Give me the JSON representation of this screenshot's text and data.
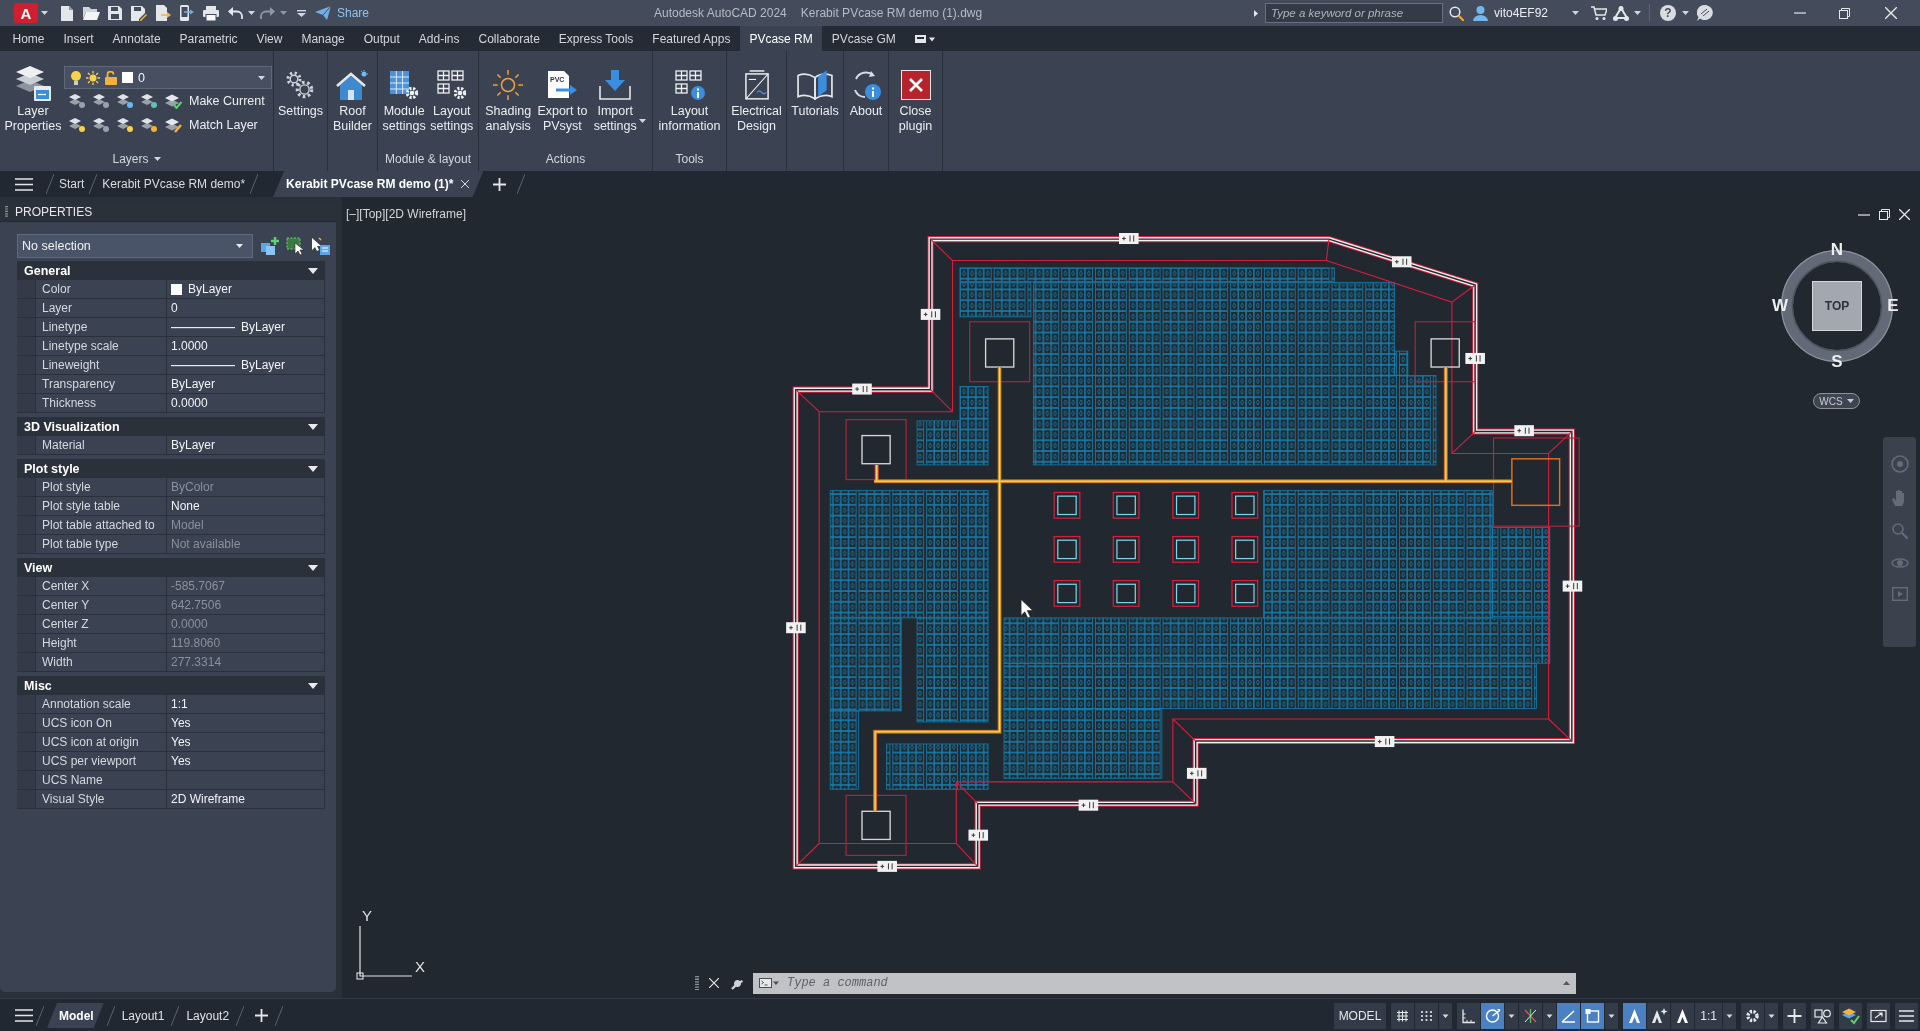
{
  "window": {
    "logo_letter": "A",
    "share_label": "Share",
    "app_title": "Autodesk AutoCAD 2024",
    "document_title": "Kerabit PVcase RM demo (1).dwg",
    "search": {
      "placeholder": "Type a keyword or phrase"
    },
    "user": "vito4EF92",
    "help_symbol": "?"
  },
  "ribbon_tabs": [
    {
      "label": "Home",
      "selected": false
    },
    {
      "label": "Insert",
      "selected": false
    },
    {
      "label": "Annotate",
      "selected": false
    },
    {
      "label": "Parametric",
      "selected": false
    },
    {
      "label": "View",
      "selected": false
    },
    {
      "label": "Manage",
      "selected": false
    },
    {
      "label": "Output",
      "selected": false
    },
    {
      "label": "Add-ins",
      "selected": false
    },
    {
      "label": "Collaborate",
      "selected": false
    },
    {
      "label": "Express Tools",
      "selected": false
    },
    {
      "label": "Featured Apps",
      "selected": false
    },
    {
      "label": "PVcase RM",
      "selected": true
    },
    {
      "label": "PVcase GM",
      "selected": false
    }
  ],
  "ribbon_panels": [
    {
      "kind": "layers",
      "title": "Layers",
      "layer_properties": "Layer\nProperties",
      "current_layer": "0",
      "buttons": [
        "Make Current",
        "Match Layer"
      ]
    },
    {
      "kind": "buttons",
      "buttons": [
        {
          "label": "Settings"
        }
      ]
    },
    {
      "kind": "buttons",
      "buttons": [
        {
          "label": "Roof\nBuilder"
        }
      ]
    },
    {
      "kind": "buttons",
      "title": "Module & layout",
      "buttons": [
        {
          "label": "Module\nsettings"
        },
        {
          "label": "Layout\nsettings"
        }
      ]
    },
    {
      "kind": "buttons",
      "title": "Actions",
      "buttons": [
        {
          "label": "Shading\nanalysis"
        },
        {
          "label": "Export to\nPVsyst",
          "icon_text": "PVC"
        },
        {
          "label": "Import\nsettings",
          "has_menu": true
        }
      ]
    },
    {
      "kind": "buttons",
      "title": "Tools",
      "buttons": [
        {
          "label": "Layout\ninformation"
        }
      ]
    },
    {
      "kind": "buttons",
      "buttons": [
        {
          "label": "Electrical\nDesign"
        }
      ]
    },
    {
      "kind": "buttons",
      "buttons": [
        {
          "label": "Tutorials"
        }
      ]
    },
    {
      "kind": "buttons",
      "buttons": [
        {
          "label": "About"
        }
      ]
    },
    {
      "kind": "buttons",
      "buttons": [
        {
          "label": "Close\nplugin"
        }
      ]
    }
  ],
  "file_tabs": [
    {
      "label": "Start",
      "selected": false
    },
    {
      "label": "Kerabit PVcase RM demo*",
      "selected": false
    },
    {
      "label": "Kerabit PVcase RM demo (1)*",
      "selected": true
    }
  ],
  "properties": {
    "title": "PROPERTIES",
    "selection": "No selection",
    "sections": [
      {
        "title": "General",
        "expanded": true,
        "rows": [
          {
            "label": "Color",
            "value": "ByLayer",
            "kind": "swatch",
            "disabled": false
          },
          {
            "label": "Layer",
            "value": "0",
            "kind": "text",
            "disabled": false
          },
          {
            "label": "Linetype",
            "value": "ByLayer",
            "kind": "line",
            "disabled": false
          },
          {
            "label": "Linetype scale",
            "value": "1.0000",
            "kind": "text",
            "disabled": false
          },
          {
            "label": "Lineweight",
            "value": "ByLayer",
            "kind": "line",
            "disabled": false
          },
          {
            "label": "Transparency",
            "value": "ByLayer",
            "kind": "text",
            "disabled": false
          },
          {
            "label": "Thickness",
            "value": "0.0000",
            "kind": "text",
            "disabled": false
          }
        ]
      },
      {
        "title": "3D Visualization",
        "expanded": true,
        "rows": [
          {
            "label": "Material",
            "value": "ByLayer",
            "kind": "text",
            "disabled": false
          }
        ]
      },
      {
        "title": "Plot style",
        "expanded": true,
        "rows": [
          {
            "label": "Plot style",
            "value": "ByColor",
            "kind": "text",
            "disabled": true
          },
          {
            "label": "Plot style table",
            "value": "None",
            "kind": "text",
            "disabled": false
          },
          {
            "label": "Plot table attached to",
            "value": "Model",
            "kind": "text",
            "disabled": true
          },
          {
            "label": "Plot table type",
            "value": "Not available",
            "kind": "text",
            "disabled": true
          }
        ]
      },
      {
        "title": "View",
        "expanded": true,
        "rows": [
          {
            "label": "Center X",
            "value": "-585.7067",
            "kind": "text",
            "disabled": true
          },
          {
            "label": "Center Y",
            "value": "642.7506",
            "kind": "text",
            "disabled": true
          },
          {
            "label": "Center Z",
            "value": "0.0000",
            "kind": "text",
            "disabled": true
          },
          {
            "label": "Height",
            "value": "119.8060",
            "kind": "text",
            "disabled": true
          },
          {
            "label": "Width",
            "value": "277.3314",
            "kind": "text",
            "disabled": true
          }
        ]
      },
      {
        "title": "Misc",
        "expanded": true,
        "rows": [
          {
            "label": "Annotation scale",
            "value": "1:1",
            "kind": "text",
            "disabled": false
          },
          {
            "label": "UCS icon On",
            "value": "Yes",
            "kind": "text",
            "disabled": false
          },
          {
            "label": "UCS icon at origin",
            "value": "Yes",
            "kind": "text",
            "disabled": false
          },
          {
            "label": "UCS per viewport",
            "value": "Yes",
            "kind": "text",
            "disabled": false
          },
          {
            "label": "UCS Name",
            "kind": "text"
          },
          {
            "label": "Visual Style",
            "value": "2D Wireframe",
            "kind": "text",
            "disabled": false
          }
        ]
      }
    ]
  },
  "viewport": {
    "label": "[–][Top][2D Wireframe]",
    "viewcube": {
      "north": "N",
      "east": "E",
      "south": "S",
      "west": "W",
      "face": "TOP",
      "ucs": "WCS"
    },
    "ucs_icon": {
      "y_label": "Y",
      "x_label": "X"
    }
  },
  "command_line": {
    "placeholder": "Type a command"
  },
  "layout_tabs": [
    {
      "label": "Model",
      "selected": true
    },
    {
      "label": "Layout1",
      "selected": false
    },
    {
      "label": "Layout2",
      "selected": false
    }
  ],
  "status_bar": {
    "space": "MODEL",
    "toggles": [
      {
        "on": false
      },
      {
        "on": false
      },
      {
        "on": false
      },
      {
        "on": true
      },
      {
        "on": false
      },
      {
        "on": true
      },
      {
        "on": true
      },
      {
        "on": true
      },
      {
        "on": false
      },
      {
        "on": false
      }
    ],
    "annotation_scale": "1:1"
  }
}
